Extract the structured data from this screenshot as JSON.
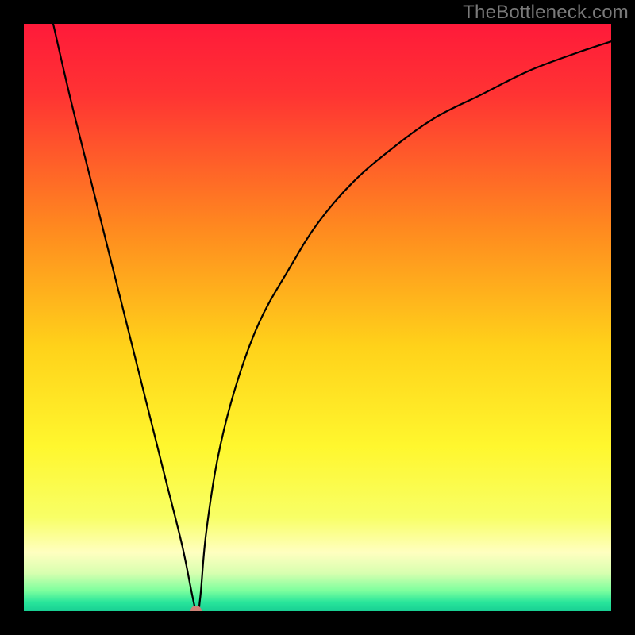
{
  "watermark": "TheBottleneck.com",
  "chart_data": {
    "type": "line",
    "title": "",
    "xlabel": "",
    "ylabel": "",
    "xlim": [
      0,
      100
    ],
    "ylim": [
      0,
      100
    ],
    "grid": false,
    "legend": false,
    "series": [
      {
        "name": "bottleneck-curve",
        "x": [
          5,
          8,
          12,
          16,
          20,
          24,
          27,
          29.3,
          30,
          31,
          33,
          36,
          40,
          45,
          50,
          56,
          63,
          70,
          78,
          86,
          94,
          100
        ],
        "y": [
          100,
          87,
          71,
          55,
          39,
          23,
          11,
          0,
          2,
          13,
          26,
          38,
          49,
          58,
          66,
          73,
          79,
          84,
          88,
          92,
          95,
          97
        ]
      }
    ],
    "marker": {
      "x": 29.3,
      "y": 0,
      "color": "#cf8277"
    },
    "background_gradient": [
      {
        "stop": 0,
        "color": "#ff1a3a"
      },
      {
        "stop": 0.12,
        "color": "#ff3333"
      },
      {
        "stop": 0.35,
        "color": "#ff8a1f"
      },
      {
        "stop": 0.55,
        "color": "#ffd21a"
      },
      {
        "stop": 0.72,
        "color": "#fff72e"
      },
      {
        "stop": 0.84,
        "color": "#f8ff66"
      },
      {
        "stop": 0.9,
        "color": "#ffffc0"
      },
      {
        "stop": 0.935,
        "color": "#d8ffb0"
      },
      {
        "stop": 0.965,
        "color": "#7dff9e"
      },
      {
        "stop": 0.985,
        "color": "#28e59b"
      },
      {
        "stop": 1.0,
        "color": "#18cf93"
      }
    ]
  }
}
